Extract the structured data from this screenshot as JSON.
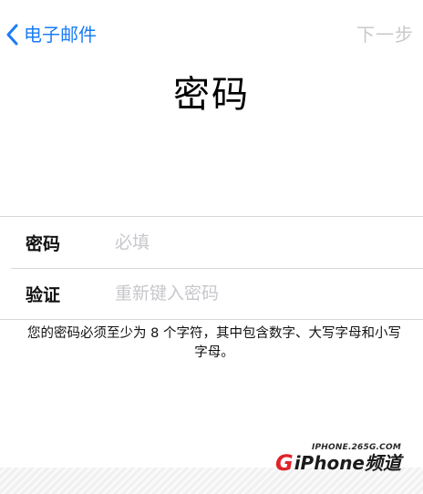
{
  "nav": {
    "back_label": "电子邮件",
    "next_label": "下一步"
  },
  "title": "密码",
  "form": {
    "password": {
      "label": "密码",
      "placeholder": "必填",
      "value": ""
    },
    "verify": {
      "label": "验证",
      "placeholder": "重新键入密码",
      "value": ""
    }
  },
  "hint": "您的密码必须至少为 8 个字符，其中包含数字、大写字母和小写字母。",
  "watermark": {
    "url": "IPHONE.265G.COM",
    "logo_g": "G",
    "logo_iphone": "iPhone",
    "logo_cn": "频道"
  },
  "colors": {
    "accent": "#1a7cf6",
    "disabled": "#c9c9cd",
    "placeholder": "#c7c7cc",
    "separator": "#d8d8d8"
  },
  "icons": {
    "back": "chevron-left-icon"
  }
}
